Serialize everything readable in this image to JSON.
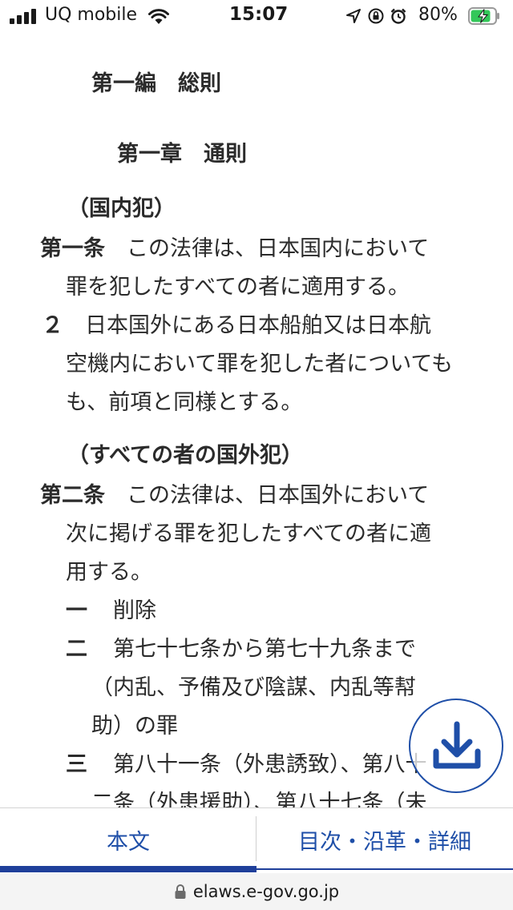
{
  "status_bar": {
    "carrier": "UQ mobile",
    "time": "15:07",
    "battery": "80%"
  },
  "content": {
    "part_title": "第一編　総則",
    "chapter_title": "第一章　通則",
    "article1": {
      "caption": "（国内犯）",
      "number": "第一条",
      "line1": "　この法律は、日本国内において",
      "line2": "罪を犯したすべての者に適用する。",
      "para2_number": "２",
      "para2_line1": "　日本国外にある日本船舶又は日本航",
      "para2_line2": "空機内において罪を犯した者についても",
      "para2_line3": "も、前項と同様とする。"
    },
    "article2": {
      "caption": "（すべての者の国外犯）",
      "number": "第二条",
      "line1": "　この法律は、日本国外において",
      "line2": "次に掲げる罪を犯したすべての者に適",
      "line3": "用する。",
      "items": [
        {
          "num": "一",
          "line1": "　削除"
        },
        {
          "num": "二",
          "line1": "　第七十七条から第七十九条まで",
          "line2": "（内乱、予備及び陰謀、内乱等幇",
          "line3": "助）の罪"
        },
        {
          "num": "三",
          "line1": "　第八十一条（外患誘致）、第八十",
          "line2": "二条（外患援助）、第八十七条（未"
        }
      ]
    }
  },
  "tabbar": {
    "tab1": "本文",
    "tab2": "目次・沿革・詳細"
  },
  "urlbar": {
    "url": "elaws.e-gov.go.jp"
  },
  "colors": {
    "accent": "#1f4fa8",
    "text": "#2b2b2b"
  }
}
